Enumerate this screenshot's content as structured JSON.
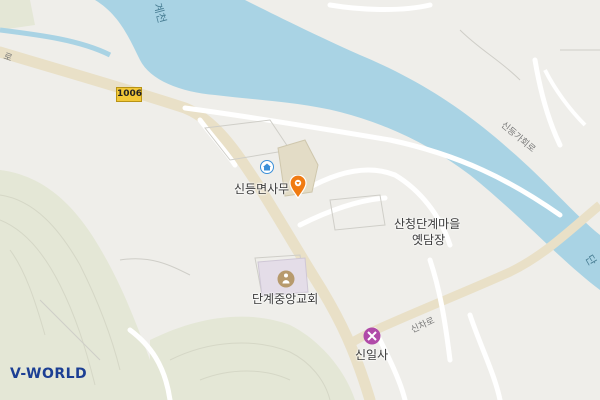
{
  "map": {
    "labels": {
      "office": "신등면사무",
      "market": "산청단계마을",
      "market2": "옛담장",
      "church": "단계중앙교회",
      "temple": "신일사",
      "stream_top": "계천",
      "stream_right": "단",
      "road_singa": "신등가회로",
      "road_sincha": "신차로",
      "road_left": "로",
      "route_number": "1006"
    },
    "icons": {
      "office": "government-office-icon",
      "pin": "location-pin-icon",
      "church": "church-icon",
      "temple": "temple-icon"
    },
    "colors": {
      "background": "#efeeea",
      "water": "#a9d3e4",
      "main_road": "#e9e0c7",
      "green": "#e4e7d6",
      "pin": "#f07b12",
      "temple": "#b04aa8"
    },
    "logo": {
      "brand": "V-WORLD"
    }
  }
}
